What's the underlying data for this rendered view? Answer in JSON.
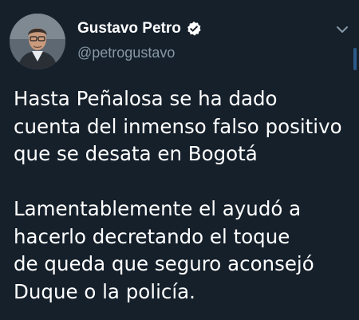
{
  "tweet": {
    "author": {
      "display_name": "Gustavo Petro",
      "handle": "@petrogustavo",
      "verified": true
    },
    "paragraphs": [
      {
        "lines": [
          "Hasta Peñalosa se ha dado",
          "cuenta del inmenso falso positivo",
          "que se desata en Bogotá"
        ]
      },
      {
        "lines": [
          "Lamentablemente el ayudó a",
          "hacerlo decretando el toque",
          "de queda que seguro aconsejó",
          "Duque o la policía."
        ]
      }
    ]
  },
  "icons": {
    "verified": "verified-badge-icon",
    "menu": "chevron-down-icon"
  },
  "colors": {
    "background": "#15202b",
    "text_primary": "#ffffff",
    "text_secondary": "#8899a6",
    "accent": "#1da1f2"
  }
}
